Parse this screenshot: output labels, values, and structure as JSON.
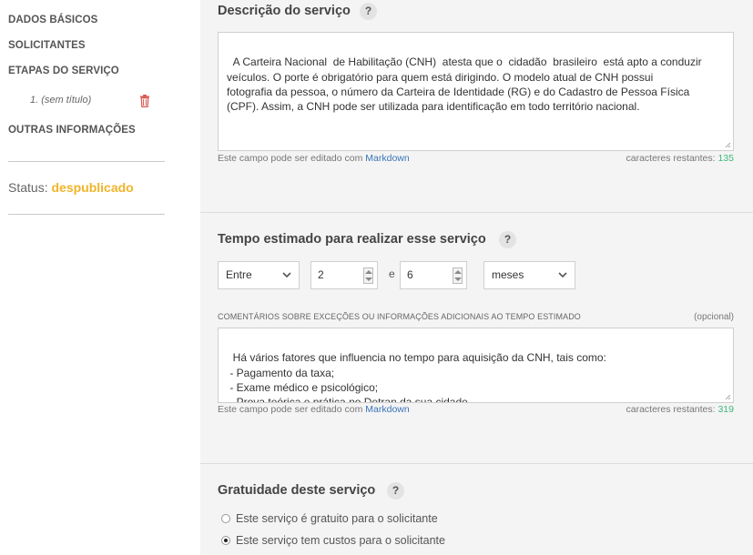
{
  "sidebar": {
    "items": [
      "DADOS BÁSICOS",
      "SOLICITANTES",
      "ETAPAS DO SERVIÇO",
      "OUTRAS INFORMAÇÕES"
    ],
    "step_item": "1. (sem título)",
    "status_label": "Status:",
    "status_value": "despublicado",
    "status_color": "#f0b429"
  },
  "descricao": {
    "title": "Descrição do serviço",
    "help": "?",
    "text": "A Carteira Nacional  de Habilitação (CNH)  atesta que o  cidadão  brasileiro  está apto a conduzir\nveículos. O porte é obrigatório para quem está dirigindo. O modelo atual de CNH possui\nfotografia da pessoa, o número da Carteira de Identidade (RG) e do Cadastro de Pessoa Física\n(CPF). Assim, a CNH pode ser utilizada para identificação em todo território nacional.",
    "hint_prefix": "Este campo pode ser editado com",
    "hint_link": "Markdown",
    "remaining_label": "caracteres restantes:",
    "remaining_count": "135"
  },
  "tempo": {
    "title": "Tempo estimado para realizar esse serviço",
    "help": "?",
    "range_select": "Entre",
    "min_value": "2",
    "and_label": "e",
    "max_value": "6",
    "unit_select": "meses",
    "comments_label": "COMENTÁRIOS SOBRE EXCEÇÕES OU INFORMAÇÕES ADICIONAIS AO TEMPO ESTIMADO",
    "optional_label": "(opcional)",
    "comments_text": "Há vários fatores que influencia no tempo para aquisição da CNH, tais como:\n - Pagamento da taxa;\n - Exame médico e psicológico;\n - Prova teórica e prática no Detran da sua cidade.",
    "hint_prefix": "Este campo pode ser editado com",
    "hint_link": "Markdown",
    "remaining_label": "caracteres restantes:",
    "remaining_count": "319"
  },
  "gratuidade": {
    "title": "Gratuidade deste serviço",
    "help": "?",
    "options": [
      "Este serviço é gratuito para o solicitante",
      "Este serviço tem custos para o solicitante"
    ],
    "selected_index": 1
  },
  "colors": {
    "link": "#3a74b8",
    "count": "#3fb87a",
    "trash": "#d9534f"
  }
}
